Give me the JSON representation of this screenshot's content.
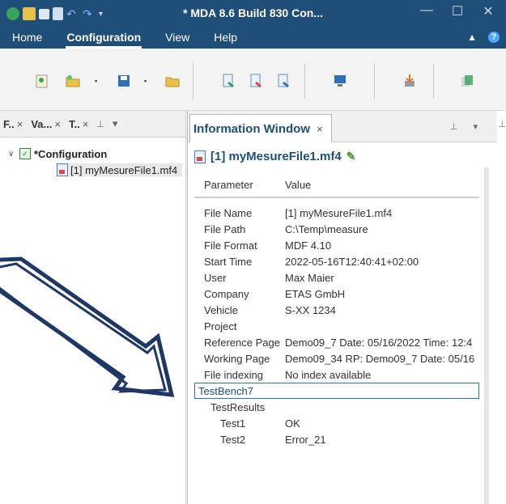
{
  "titlebar": {
    "title": "* MDA 8.6 Build 830 Con...",
    "controls": {
      "minimize": "—",
      "maximize": "☐",
      "close": "✕"
    }
  },
  "menu": {
    "tabs": [
      "Home",
      "Configuration",
      "View",
      "Help"
    ],
    "active": "Configuration",
    "collapse": "▲",
    "help_icon": "?"
  },
  "left_panel": {
    "tabs": [
      {
        "label": "F..",
        "close": "×"
      },
      {
        "label": "Va...",
        "close": "×"
      },
      {
        "label": "T..",
        "close": "×"
      }
    ],
    "pin": "⊥",
    "dropdown": "▾",
    "tree": {
      "root": "*Configuration",
      "child": "[1] myMesureFile1.mf4"
    }
  },
  "info_window": {
    "tab_title": "Information Window",
    "tab_close": "×",
    "file_title": "[1] myMesureFile1.mf4",
    "headers": {
      "parameter": "Parameter",
      "value": "Value"
    },
    "rows": [
      {
        "p": "File Name",
        "v": "[1] myMesureFile1.mf4"
      },
      {
        "p": "File Path",
        "v": "C:\\Temp\\measure"
      },
      {
        "p": "File Format",
        "v": "MDF 4.10"
      },
      {
        "p": "Start Time",
        "v": "2022-05-16T12:40:41+02:00"
      },
      {
        "p": "User",
        "v": "Max Maier"
      },
      {
        "p": "Company",
        "v": "ETAS GmbH"
      },
      {
        "p": "Vehicle",
        "v": "S-XX 1234"
      },
      {
        "p": "Project",
        "v": ""
      },
      {
        "p": "Reference Page",
        "v": "Demo09_7 Date: 05/16/2022 Time: 12:4"
      },
      {
        "p": "Working Page",
        "v": "Demo09_34 RP: Demo09_7 Date: 05/16"
      },
      {
        "p": "File indexing",
        "v": "No index available"
      }
    ],
    "section": "TestBench7",
    "subsection": "TestResults",
    "results": [
      {
        "p": "Test1",
        "v": "OK"
      },
      {
        "p": "Test2",
        "v": "Error_21"
      }
    ]
  },
  "icons": [
    "app-icon",
    "folder-icon",
    "save-icon",
    "export-icon",
    "undo-icon",
    "redo-icon",
    "config-icon",
    "open-folder-icon",
    "save-icon",
    "folder-icon",
    "add-file-icon",
    "remove-file-icon",
    "replace-file-icon",
    "monitor-icon",
    "import-icon",
    "copy-icon",
    "pencil-icon",
    "file-mf4-icon",
    "pin-icon",
    "callout-arrow"
  ]
}
